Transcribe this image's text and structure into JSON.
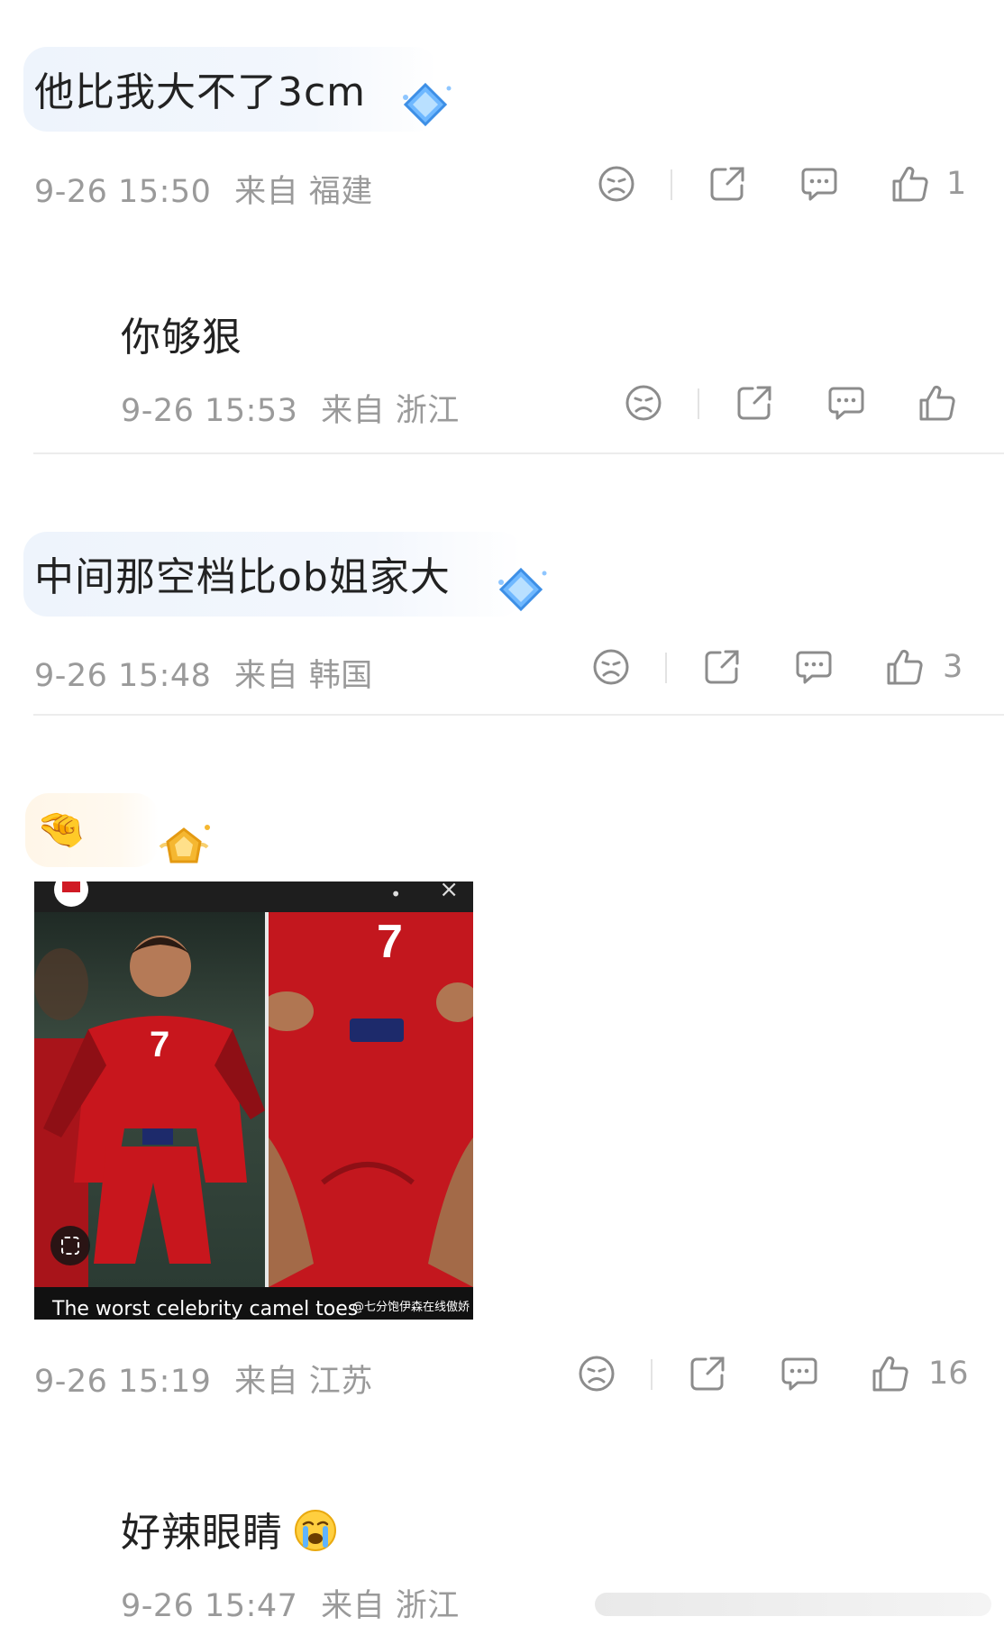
{
  "comments": [
    {
      "text": "他比我大不了3cm",
      "time": "9-26 15:50",
      "from_label": "来自",
      "location": "福建",
      "like_count": "1",
      "badge": "diamond-badge"
    },
    {
      "text": "你够狠",
      "time": "9-26 15:53",
      "from_label": "来自",
      "location": "浙江",
      "like_count": ""
    },
    {
      "text": "中间那空档比ob姐家大",
      "time": "9-26 15:48",
      "from_label": "来自",
      "location": "韩国",
      "like_count": "3",
      "badge": "diamond-badge"
    },
    {
      "text": "🤏",
      "time": "9-26 15:19",
      "from_label": "来自",
      "location": "江苏",
      "like_count": "16",
      "badge": "gold-crown-badge",
      "image": {
        "caption": "The worst celebrity camel toes",
        "watermark": "@七分饱伊森在线傲娇"
      }
    },
    {
      "text": "好辣眼睛",
      "emoji": "crying-face",
      "time": "9-26 15:47",
      "from_label": "来自",
      "location": "浙江"
    }
  ],
  "icons": {
    "dislike": "sad-face-icon",
    "share": "share-icon",
    "reply": "comment-bubble-icon",
    "like": "thumbs-up-icon"
  },
  "colors": {
    "meta_text": "#9a9a9a",
    "icon_stroke": "#8c8c8c",
    "badge_blue": "#5aa8f0",
    "badge_gold": "#f5b731"
  }
}
